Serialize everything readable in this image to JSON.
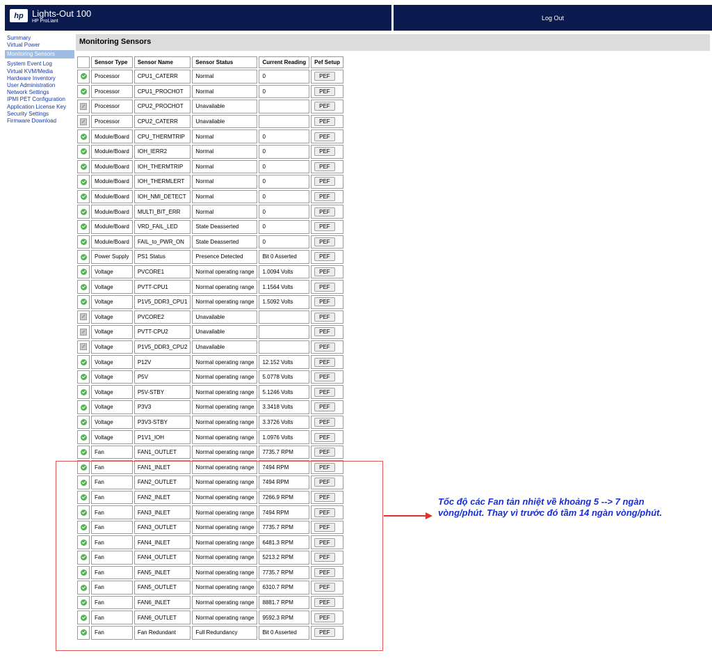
{
  "brand": {
    "logo": "hp",
    "title": "Lights-Out 100",
    "subtitle": "HP ProLiant"
  },
  "header": {
    "logout": "Log Out"
  },
  "nav": {
    "items": [
      {
        "label": "Summary",
        "active": false
      },
      {
        "label": "Virtual Power",
        "active": false
      },
      {
        "label": "Monitoring Sensors",
        "active": true
      },
      {
        "label": "System Event Log",
        "active": false
      },
      {
        "label": "Virtual KVM/Media",
        "active": false
      },
      {
        "label": "Hardware Inventory",
        "active": false
      },
      {
        "label": "User Administration",
        "active": false
      },
      {
        "label": "Network Settings",
        "active": false
      },
      {
        "label": "IPMI PET Configuration",
        "active": false
      },
      {
        "label": "Application License Key",
        "active": false
      },
      {
        "label": "Security Settings",
        "active": false
      },
      {
        "label": "Firmware Download",
        "active": false
      }
    ]
  },
  "page_title": "Monitoring Sensors",
  "table": {
    "headers": [
      "Sensor Type",
      "Sensor Name",
      "Sensor Status",
      "Current Reading",
      "Pef Setup"
    ],
    "button_label": "PEF",
    "rows": [
      {
        "icon": "ok",
        "type": "Processor",
        "name": "CPU1_CATERR",
        "status": "Normal",
        "reading": "0"
      },
      {
        "icon": "ok",
        "type": "Processor",
        "name": "CPU1_PROCHOT",
        "status": "Normal",
        "reading": "0"
      },
      {
        "icon": "na",
        "type": "Processor",
        "name": "CPU2_PROCHOT",
        "status": "Unavailable",
        "reading": ""
      },
      {
        "icon": "na",
        "type": "Processor",
        "name": "CPU2_CATERR",
        "status": "Unavailable",
        "reading": ""
      },
      {
        "icon": "ok",
        "type": "Module/Board",
        "name": "CPU_THERMTRIP",
        "status": "Normal",
        "reading": "0"
      },
      {
        "icon": "ok",
        "type": "Module/Board",
        "name": "IOH_IERR2",
        "status": "Normal",
        "reading": "0"
      },
      {
        "icon": "ok",
        "type": "Module/Board",
        "name": "IOH_THERMTRIP",
        "status": "Normal",
        "reading": "0"
      },
      {
        "icon": "ok",
        "type": "Module/Board",
        "name": "IOH_THERMLERT",
        "status": "Normal",
        "reading": "0"
      },
      {
        "icon": "ok",
        "type": "Module/Board",
        "name": "IOH_NMI_DETECT",
        "status": "Normal",
        "reading": "0"
      },
      {
        "icon": "ok",
        "type": "Module/Board",
        "name": "MULTI_BIT_ERR",
        "status": "Normal",
        "reading": "0"
      },
      {
        "icon": "ok",
        "type": "Module/Board",
        "name": "VRD_FAIL_LED",
        "status": "State Deasserted",
        "reading": "0"
      },
      {
        "icon": "ok",
        "type": "Module/Board",
        "name": "FAIL_to_PWR_ON",
        "status": "State Deasserted",
        "reading": "0"
      },
      {
        "icon": "ok",
        "type": "Power Supply",
        "name": "PS1 Status",
        "status": "Presence Detected",
        "reading": "Bit 0 Asserted"
      },
      {
        "icon": "ok",
        "type": "Voltage",
        "name": "PVCORE1",
        "status": "Normal operating range",
        "reading": "1.0094 Volts"
      },
      {
        "icon": "ok",
        "type": "Voltage",
        "name": "PVTT-CPU1",
        "status": "Normal operating range",
        "reading": "1.1564 Volts"
      },
      {
        "icon": "ok",
        "type": "Voltage",
        "name": "P1V5_DDR3_CPU1",
        "status": "Normal operating range",
        "reading": "1.5092 Volts"
      },
      {
        "icon": "na",
        "type": "Voltage",
        "name": "PVCORE2",
        "status": "Unavailable",
        "reading": ""
      },
      {
        "icon": "na",
        "type": "Voltage",
        "name": "PVTT-CPU2",
        "status": "Unavailable",
        "reading": ""
      },
      {
        "icon": "na",
        "type": "Voltage",
        "name": "P1V5_DDR3_CPU2",
        "status": "Unavailable",
        "reading": ""
      },
      {
        "icon": "ok",
        "type": "Voltage",
        "name": "P12V",
        "status": "Normal operating range",
        "reading": "12.152 Volts"
      },
      {
        "icon": "ok",
        "type": "Voltage",
        "name": "P5V",
        "status": "Normal operating range",
        "reading": "5.0778 Volts"
      },
      {
        "icon": "ok",
        "type": "Voltage",
        "name": "P5V-STBY",
        "status": "Normal operating range",
        "reading": "5.1246 Volts"
      },
      {
        "icon": "ok",
        "type": "Voltage",
        "name": "P3V3",
        "status": "Normal operating range",
        "reading": "3.3418 Volts"
      },
      {
        "icon": "ok",
        "type": "Voltage",
        "name": "P3V3-STBY",
        "status": "Normal operating range",
        "reading": "3.3726 Volts"
      },
      {
        "icon": "ok",
        "type": "Voltage",
        "name": "P1V1_IOH",
        "status": "Normal operating range",
        "reading": "1.0976 Volts"
      },
      {
        "icon": "ok",
        "type": "Fan",
        "name": "FAN1_OUTLET",
        "status": "Normal operating range",
        "reading": "7735.7 RPM"
      },
      {
        "icon": "ok",
        "type": "Fan",
        "name": "FAN1_INLET",
        "status": "Normal operating range",
        "reading": "7494 RPM"
      },
      {
        "icon": "ok",
        "type": "Fan",
        "name": "FAN2_OUTLET",
        "status": "Normal operating range",
        "reading": "7494 RPM"
      },
      {
        "icon": "ok",
        "type": "Fan",
        "name": "FAN2_INLET",
        "status": "Normal operating range",
        "reading": "7266.9 RPM"
      },
      {
        "icon": "ok",
        "type": "Fan",
        "name": "FAN3_INLET",
        "status": "Normal operating range",
        "reading": "7494 RPM"
      },
      {
        "icon": "ok",
        "type": "Fan",
        "name": "FAN3_OUTLET",
        "status": "Normal operating range",
        "reading": "7735.7 RPM"
      },
      {
        "icon": "ok",
        "type": "Fan",
        "name": "FAN4_INLET",
        "status": "Normal operating range",
        "reading": "6481.3 RPM"
      },
      {
        "icon": "ok",
        "type": "Fan",
        "name": "FAN4_OUTLET",
        "status": "Normal operating range",
        "reading": "5213.2 RPM"
      },
      {
        "icon": "ok",
        "type": "Fan",
        "name": "FAN5_INLET",
        "status": "Normal operating range",
        "reading": "7735.7 RPM"
      },
      {
        "icon": "ok",
        "type": "Fan",
        "name": "FAN5_OUTLET",
        "status": "Normal operating range",
        "reading": "6310.7 RPM"
      },
      {
        "icon": "ok",
        "type": "Fan",
        "name": "FAN6_INLET",
        "status": "Normal operating range",
        "reading": "8881.7 RPM"
      },
      {
        "icon": "ok",
        "type": "Fan",
        "name": "FAN6_OUTLET",
        "status": "Normal operating range",
        "reading": "9592.3 RPM"
      },
      {
        "icon": "ok",
        "type": "Fan",
        "name": "Fan Redundant",
        "status": "Full Redundancy",
        "reading": "Bit 0 Asserted"
      }
    ]
  },
  "annotation": {
    "text": "Tốc độ các Fan tản nhiệt về khoảng 5 --> 7 ngàn vòng/phút. Thay vì trước đó tầm 14 ngàn vòng/phút.",
    "color": "#1a2ed0",
    "box_color": "#e05555"
  }
}
